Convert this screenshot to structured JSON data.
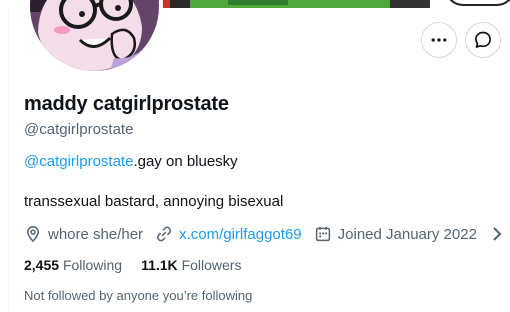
{
  "profile": {
    "display_name": "maddy catgirlprostate",
    "handle": "@catgirlprostate",
    "bio_link": "@catgirlprostate",
    "bio_link_suffix": ".gay on bluesky",
    "bio_text": "transsexual bastard, annoying bisexual",
    "pronouns": "whore she/her",
    "website": "x.com/girlfaggot69",
    "joined": "Joined January 2022"
  },
  "stats": {
    "following_count": "2,455",
    "following_label": "Following",
    "followers_count": "11.1K",
    "followers_label": "Followers"
  },
  "social_context": "Not followed by anyone you’re following",
  "icons": {
    "more": "more-horizontal-icon",
    "message": "message-icon",
    "location": "location-icon",
    "link": "link-icon",
    "calendar": "calendar-icon",
    "chevron": "chevron-right-icon"
  },
  "colors": {
    "accent": "#1d9bf0",
    "secondary_text": "#536471",
    "primary_text": "#0f1419",
    "border": "#cfd9de"
  }
}
